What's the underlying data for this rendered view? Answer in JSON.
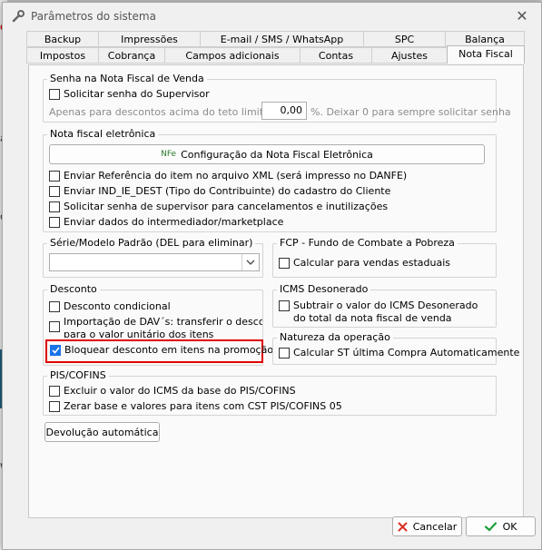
{
  "window": {
    "title": "Parâmetros do sistema",
    "close_symbol": "✕"
  },
  "tabs_row1": [
    {
      "label": "Backup"
    },
    {
      "label": "Impressões"
    },
    {
      "label": "E-mail / SMS / WhatsApp"
    },
    {
      "label": "SPC"
    },
    {
      "label": "Balança"
    }
  ],
  "tabs_row2": [
    {
      "label": "Impostos"
    },
    {
      "label": "Cobrança"
    },
    {
      "label": "Campos adicionais"
    },
    {
      "label": "Contas"
    },
    {
      "label": "Ajustes"
    },
    {
      "label": "Nota Fiscal",
      "active": true
    }
  ],
  "senha_nfv": {
    "title": "Senha na Nota Fiscal de Venda",
    "checkbox": "Solicitar senha do Supervisor",
    "limit_prefix": "Apenas para descontos acima do teto limite de:",
    "limit_value": "0,00",
    "limit_suffix": "%. Deixar 0 para sempre solicitar senha"
  },
  "nfe": {
    "title": "Nota fiscal eletrônica",
    "config_button_prefix": "NFe",
    "config_button": "Configuração da Nota Fiscal Eletrônica",
    "options": [
      "Enviar Referência do item no arquivo XML (será impresso no DANFE)",
      "Enviar IND_IE_DEST (Tipo do Contribuinte) do cadastro do Cliente",
      "Solicitar senha de supervisor para cancelamentos e inutilizações",
      "Enviar dados do intermediador/marketplace"
    ]
  },
  "serie": {
    "title": "Série/Modelo Padrão (DEL para eliminar)",
    "value": ""
  },
  "fcp": {
    "title": "FCP - Fundo de Combate a Pobreza",
    "checkbox": "Calcular para vendas estaduais"
  },
  "desconto": {
    "title": "Desconto",
    "opt1": "Desconto condicional",
    "opt2_line1": "Importação de DAV´s: transferir o desconto",
    "opt2_line2": "para o valor unitário dos itens",
    "opt3": "Bloquear desconto em itens na promoção"
  },
  "icms": {
    "title": "ICMS Desonerado",
    "line1": "Subtrair o valor do ICMS Desonerado",
    "line2": "do total da nota fiscal de venda"
  },
  "natureza": {
    "title": "Natureza da operação",
    "checkbox": "Calcular ST última Compra Automaticamente"
  },
  "pis": {
    "title": "PIS/COFINS",
    "opt1": "Excluir o valor do ICMS da base do PIS/COFINS",
    "opt2": "Zerar base e valores para itens com CST PIS/COFINS 05"
  },
  "devolucao_button": "Devolução automática",
  "cancel_button": "Cancelar",
  "ok_button": "OK",
  "background_fragments": [
    "C",
    "ar",
    "ç",
    "w"
  ],
  "colors": {
    "highlight_border": "#e00000",
    "checked_fill": "#1a73e8",
    "ok_check": "#1e9e3a",
    "cancel_x": "#d93025"
  }
}
